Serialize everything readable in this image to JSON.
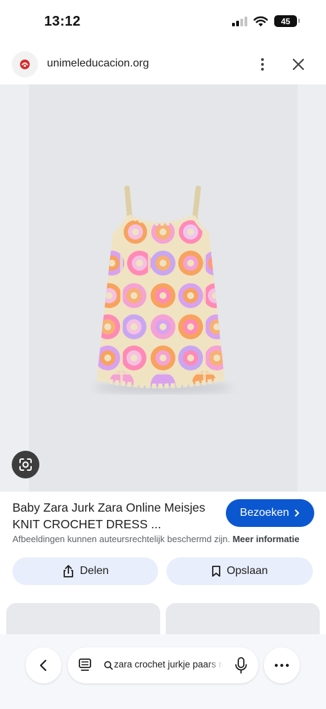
{
  "status_bar": {
    "time": "13:12",
    "battery": "45",
    "icons": [
      "cellular-signal-icon",
      "wifi-icon",
      "battery-icon"
    ]
  },
  "site": {
    "domain": "unimeleducacion.org",
    "icons": [
      "site-favicon-icon",
      "more-vert-icon",
      "close-icon"
    ]
  },
  "result": {
    "title": "Baby Zara Jurk Zara Online Meisjes KNIT CROCHET DRESS ...",
    "visit_label": "Bezoeken",
    "copyright_text": "Afbeeldingen kunnen auteursrechtelijk beschermd zijn.",
    "more_info_label": "Meer informatie"
  },
  "actions": {
    "share_label": "Delen",
    "save_label": "Opslaan"
  },
  "search": {
    "query": "zara crochet jurkje paars roze"
  },
  "colors": {
    "accent": "#0b57d0",
    "action_bg": "#e8eefb",
    "favicon_red": "#d62b2b"
  }
}
